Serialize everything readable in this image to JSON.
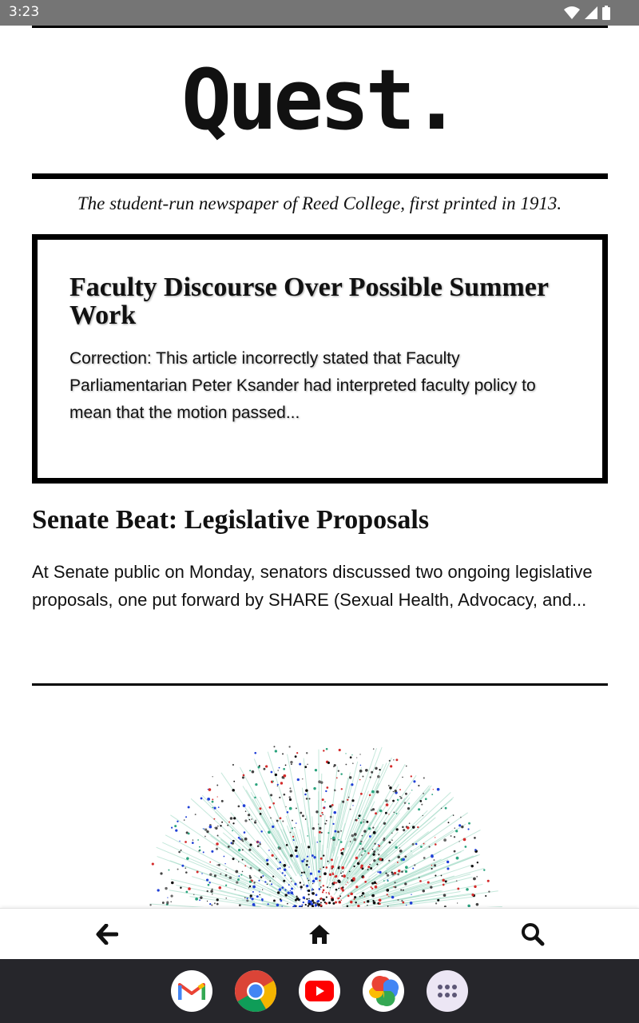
{
  "status_bar": {
    "time": "3:23"
  },
  "masthead": {
    "logo": "Quest."
  },
  "tagline": "The student-run newspaper of Reed College, first printed in 1913.",
  "featured": {
    "title": "Faculty Discourse Over Possible Summer Work",
    "summary": "Correction: This article incorrectly stated that Faculty Parliamentarian Peter Ksander had interpreted faculty policy to mean that the motion passed..."
  },
  "article": {
    "title": "Senate Beat: Legislative Proposals",
    "summary": "At Senate public on Monday, senators discussed two ongoing legislative proposals, one put forward by SHARE (Sexual Health, Advocacy, and..."
  },
  "app_nav": {
    "icons": [
      "back-arrow-icon",
      "home-icon",
      "search-icon"
    ]
  },
  "taskbar": {
    "apps": [
      "gmail-icon",
      "chrome-icon",
      "youtube-icon",
      "photos-icon",
      "app-drawer-icon"
    ]
  },
  "colors": {
    "status_bar": "#757575",
    "taskbar": "#26262b",
    "rule": "#000000"
  }
}
